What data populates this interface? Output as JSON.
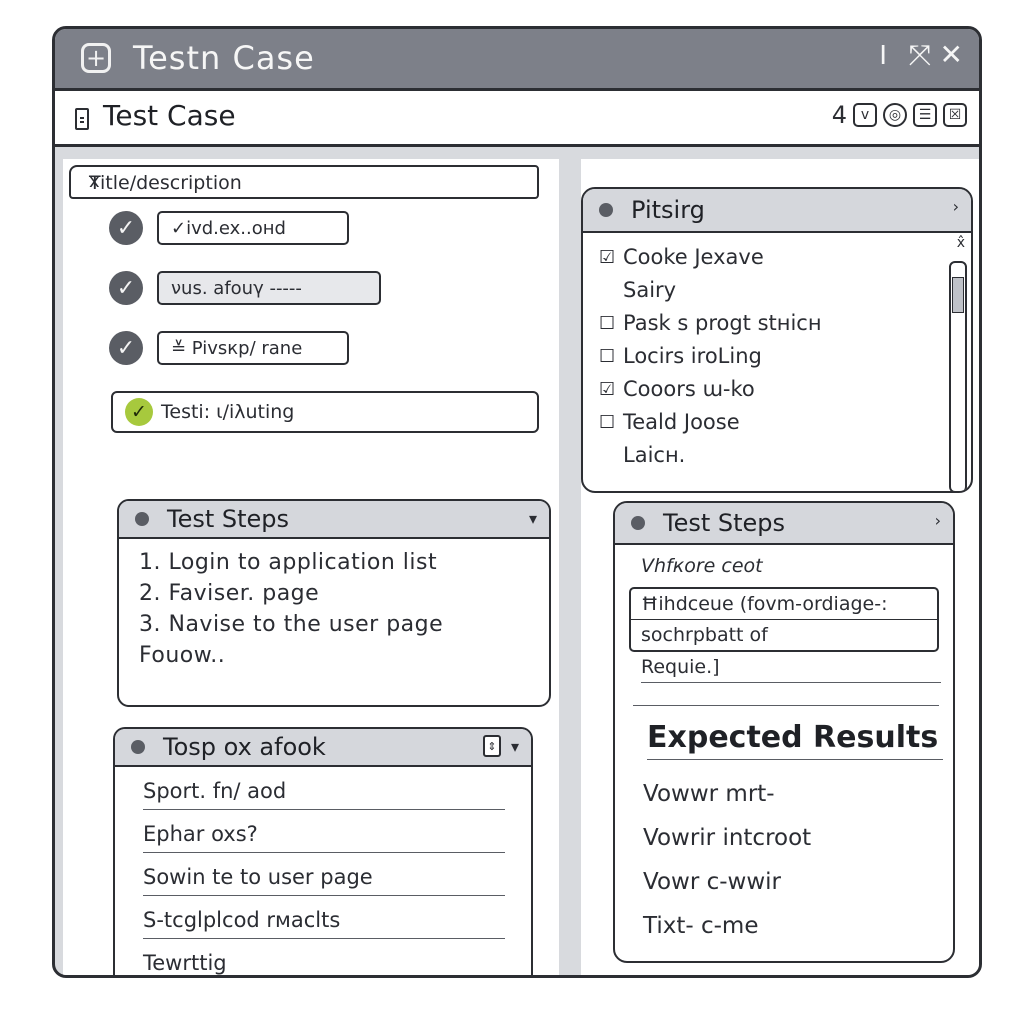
{
  "window": {
    "title": "Testn Case",
    "app_icon": "+",
    "controls": [
      "I",
      "⤧",
      "✕"
    ]
  },
  "subbar": {
    "title": "Test Case",
    "tools": [
      "4",
      "v",
      "◎",
      "☰",
      "☒"
    ]
  },
  "left": {
    "title_field": {
      "label": "Title/description",
      "clear": "x"
    },
    "checks": [
      {
        "check": "✓",
        "value": "✓ivd.ex..oнd"
      },
      {
        "check": "✓",
        "value": "νus. afouγ -----"
      },
      {
        "check": "✓",
        "value": "≚ Pivsкp/ rane"
      }
    ],
    "test_row": {
      "check": "✓",
      "value": "Testi: ι/iλuting"
    },
    "steps_card": {
      "header": "Test Steps",
      "chevron": "▾",
      "steps": [
        "1. Login to application list",
        "2. Faviser. page",
        "3. Navise to the user page",
        "Fouow.."
      ]
    },
    "list_card": {
      "header": "Tosp ox afook",
      "sort_icon": "⇕",
      "chevron": "▾",
      "rows": [
        "Sport. fn/ aod",
        "Ephar oxs?",
        "Sowin te to user page",
        "S-tcglplcod rмaclts",
        "Tewrttig"
      ]
    }
  },
  "right": {
    "prio_card": {
      "header": "Pitsirg",
      "chevron": "›",
      "scroll_top": "x̂",
      "items": [
        {
          "cb": "☑",
          "text": "Cooke Jexave"
        },
        {
          "cb": "",
          "text": "Sairy"
        },
        {
          "cb": "☐",
          "text": "Pask s progt stнicн"
        },
        {
          "cb": "☐",
          "text": "Locirs iroLing"
        },
        {
          "cb": "☑",
          "text": "Cooors ɯ-ko"
        },
        {
          "cb": "☐",
          "text": "Teald Joose"
        },
        {
          "cb": "",
          "text": "Laicн."
        }
      ]
    },
    "steps_card": {
      "header": "Test Steps",
      "chevron": "›",
      "subtitle": "Vhfкore ceot",
      "box_lines": [
        "Ħihdceue (fovm-ordiage-:",
        "sochrpbatt of"
      ],
      "required": "Requie.]",
      "expected_title": "Expected Results",
      "expected": [
        "Vowwr mrt-",
        "Vowrir intcroot",
        "Vowr c-wwir",
        "Tixt- c-me"
      ]
    }
  }
}
